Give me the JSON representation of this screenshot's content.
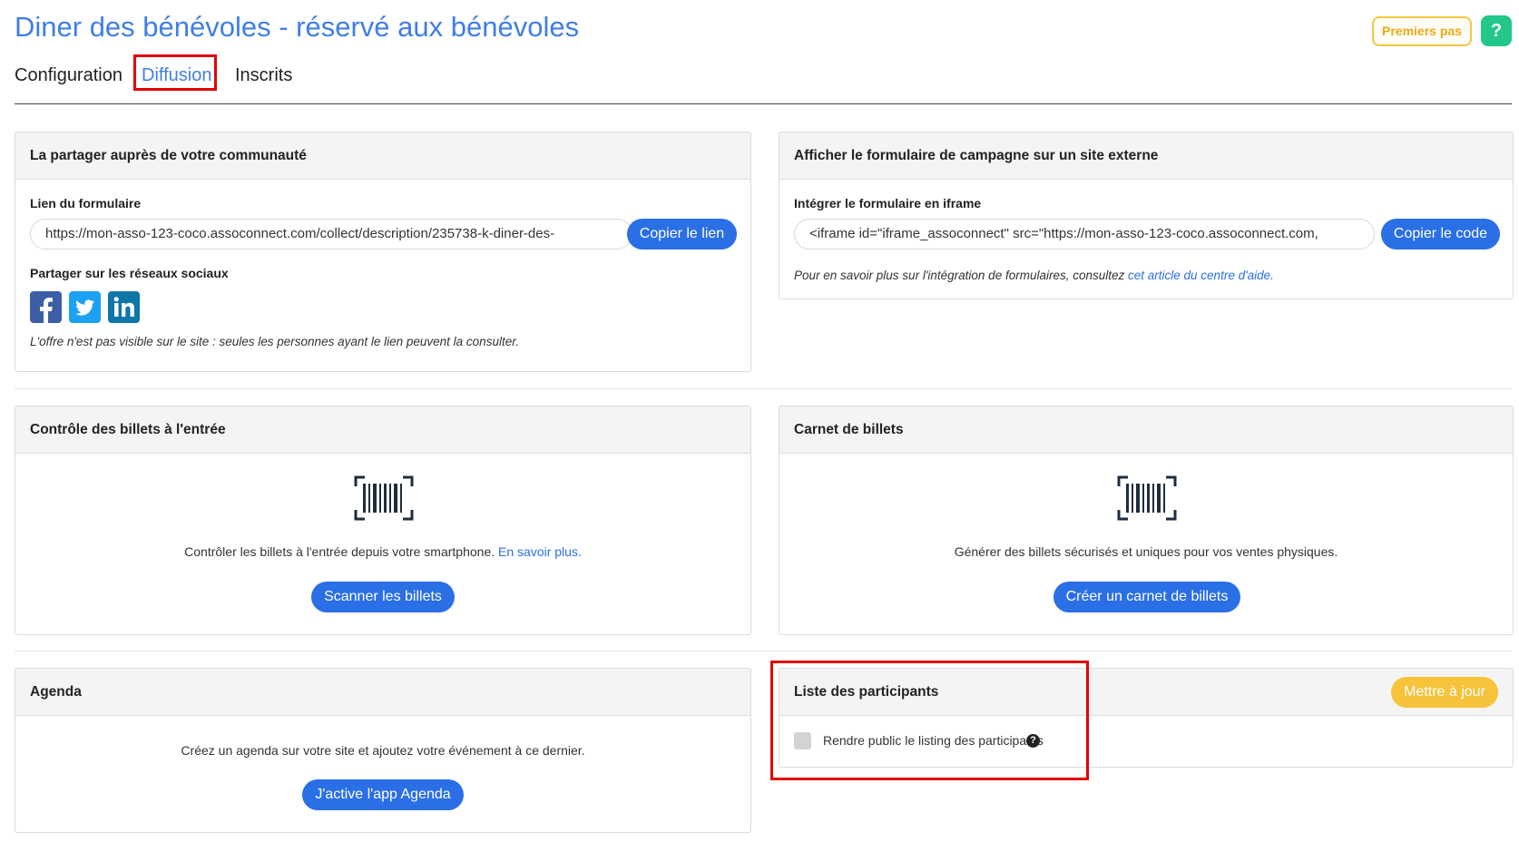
{
  "page": {
    "title": "Diner des bénévoles - réservé aux bénévoles",
    "premiers_pas": "Premiers pas",
    "help_label": "?"
  },
  "tabs": [
    {
      "label": "Configuration",
      "active": false
    },
    {
      "label": "Diffusion",
      "active": true
    },
    {
      "label": "Inscrits",
      "active": false
    }
  ],
  "share": {
    "title": "La partager auprès de votre communauté",
    "link_label": "Lien du formulaire",
    "link_value": "https://mon-asso-123-coco.assoconnect.com/collect/description/235738-k-diner-des-",
    "copy_button": "Copier le lien",
    "social_label": "Partager sur les réseaux sociaux",
    "social_icons": [
      "facebook-icon",
      "twitter-icon",
      "linkedin-icon"
    ],
    "note": "L'offre n'est pas visible sur le site : seules les personnes ayant le lien peuvent la consulter."
  },
  "external": {
    "title": "Afficher le formulaire de campagne sur un site externe",
    "iframe_label": "Intégrer le formulaire en iframe",
    "iframe_value": "<iframe id=\"iframe_assoconnect\" src=\"https://mon-asso-123-coco.assoconnect.com,",
    "copy_button": "Copier le code",
    "note_prefix": "Pour en savoir plus sur l'intégration de formulaires, consultez ",
    "note_link": "cet article du centre d'aide."
  },
  "tickets_control": {
    "title": "Contrôle des billets à l'entrée",
    "icon": "barcode-scan-icon",
    "text": "Contrôler les billets à l'entrée depuis votre smartphone. ",
    "link": "En savoir plus.",
    "button": "Scanner les billets"
  },
  "ticket_book": {
    "title": "Carnet de billets",
    "icon": "barcode-scan-icon",
    "text": "Générer des billets sécurisés et uniques pour vos ventes physiques.",
    "button": "Créer un carnet de billets"
  },
  "agenda": {
    "title": "Agenda",
    "text": "Créez un agenda sur votre site et ajoutez votre événement à ce dernier.",
    "button": "J'active l'app Agenda"
  },
  "participants": {
    "title": "Liste des participants",
    "update_button": "Mettre à jour",
    "checkbox_label": "Rendre public le listing des participants",
    "checked": false
  },
  "colors": {
    "primary": "#2a6fe6",
    "title_blue": "#3f7ee8",
    "highlight_red": "#e00000",
    "yellow": "#f6c33a",
    "green_help": "#23c78a"
  }
}
